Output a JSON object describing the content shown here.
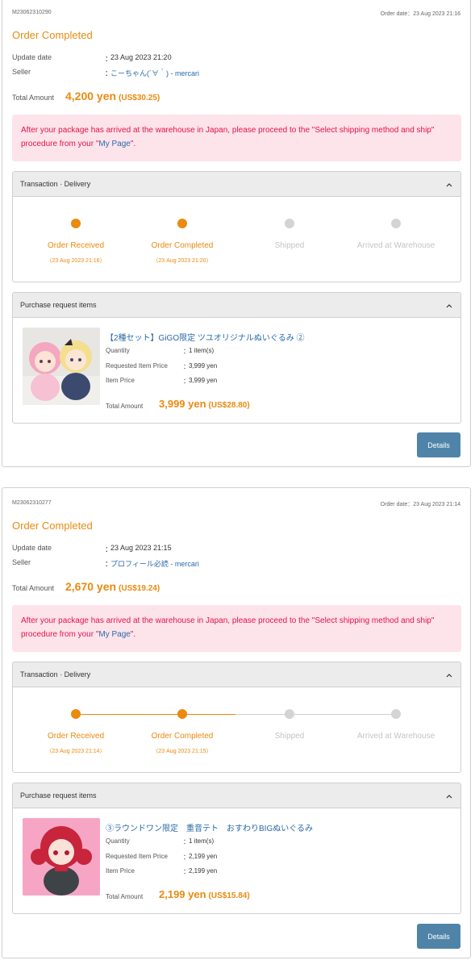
{
  "orders": [
    {
      "order_no": "M23062310290",
      "order_date": "Order date：23 Aug 2023 21:16",
      "status": "Order Completed",
      "update_label": "Update date",
      "update_value": "23 Aug 2023 21:20",
      "seller_label": "Seller",
      "seller_value": "こーちゃん(´∀｀) - mercari",
      "colon": "：",
      "total_label": "Total Amount",
      "total_yen": "4,200 yen",
      "total_usd": "(US$30.25)",
      "notice_text_before": "After your package has arrived at the warehouse in Japan, please proceed to the \"Select shipping method and ship\" procedure from your \"",
      "notice_link": "My Page",
      "notice_text_after": "\".",
      "transaction": {
        "title": "Transaction · Delivery",
        "progress_fraction": 0.5,
        "steps": [
          {
            "label": "Order Received",
            "date": "（23 Aug 2023 21:16）"
          },
          {
            "label": "Order Completed",
            "date": "（23 Aug 2023 21:20）"
          },
          {
            "label": "Shipped",
            "date": ""
          },
          {
            "label": "Arrived at Warehouse",
            "date": ""
          }
        ]
      },
      "items_panel": {
        "title": "Purchase request items",
        "item": {
          "title": "【2種セット】GiGO限定 ツユオリジナルぬいぐるみ ②",
          "quantity_label": "Quantity",
          "quantity_value": "1 item(s)",
          "requested_label": "Requested Item Price",
          "requested_value": "3,999 yen",
          "price_label": "Item Price",
          "price_value": "3,999 yen",
          "total_label": "Total Amount",
          "total_yen": "3,999 yen",
          "total_usd": "(US$28.80)"
        }
      },
      "details_label": "Details"
    },
    {
      "order_no": "M23062310277",
      "order_date": "Order date：23 Aug 2023 21:14",
      "status": "Order Completed",
      "update_label": "Update date",
      "update_value": "23 Aug 2023 21:15",
      "seller_label": "Seller",
      "seller_value": "プロフィール必読 - mercari",
      "colon": "：",
      "total_label": "Total Amount",
      "total_yen": "2,670 yen",
      "total_usd": "(US$19.24)",
      "notice_text_before": "After your package has arrived at the warehouse in Japan, please proceed to the \"Select shipping method and ship\" procedure from your \"",
      "notice_link": "My Page",
      "notice_text_after": "\".",
      "transaction": {
        "title": "Transaction · Delivery",
        "progress_fraction": 0.5,
        "steps": [
          {
            "label": "Order Received",
            "date": "（23 Aug 2023 21:14）"
          },
          {
            "label": "Order Completed",
            "date": "（23 Aug 2023 21:15）"
          },
          {
            "label": "Shipped",
            "date": ""
          },
          {
            "label": "Arrived at Warehouse",
            "date": ""
          }
        ]
      },
      "items_panel": {
        "title": "Purchase request items",
        "item": {
          "title": "③ラウンドワン限定　重音テト　おすわりBIGぬいぐるみ",
          "quantity_label": "Quantity",
          "quantity_value": "1 item(s)",
          "requested_label": "Requested Item Price",
          "requested_value": "2,199 yen",
          "price_label": "Item Price",
          "price_value": "2,199 yen",
          "total_label": "Total Amount",
          "total_yen": "2,199 yen",
          "total_usd": "(US$15.84)"
        }
      },
      "details_label": "Details"
    }
  ],
  "colors": {
    "accent": "#ea8a0e",
    "link": "#2a6aa8",
    "notice_bg": "#fde4ea",
    "notice_text": "#e6124a",
    "button": "#4f84a8",
    "inactive": "#d4d4d4"
  },
  "icons": {
    "panel_toggle": "chevron-up-icon"
  }
}
